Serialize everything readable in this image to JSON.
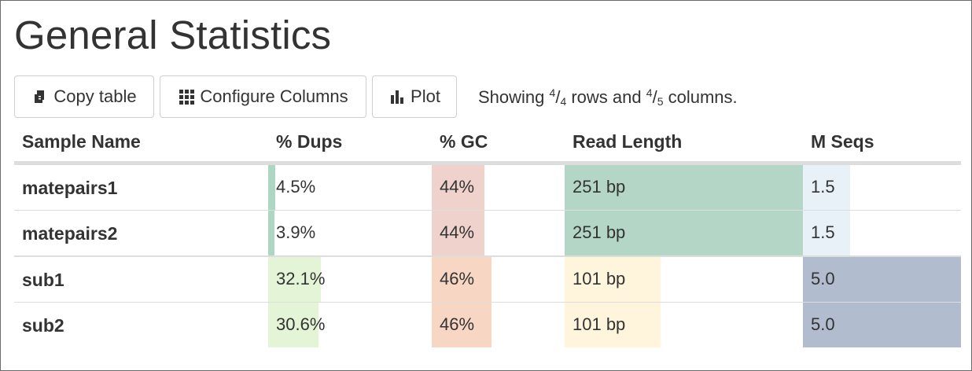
{
  "title": "General Statistics",
  "toolbar": {
    "copy_label": "Copy table",
    "configure_label": "Configure Columns",
    "plot_label": "Plot",
    "showing": {
      "prefix": "Showing",
      "rows_shown": "4",
      "rows_total": "4",
      "mid": "rows and",
      "cols_shown": "4",
      "cols_total": "5",
      "suffix": "columns."
    }
  },
  "columns": [
    "Sample Name",
    "% Dups",
    "% GC",
    "Read Length",
    "M Seqs"
  ],
  "colors": {
    "dups": [
      "#aed6c4",
      "#aed6c4",
      "#e4f4d6",
      "#e4f4d6"
    ],
    "gc": [
      "#f0d2cc",
      "#f0d2cc",
      "#f8d6c4",
      "#f8d6c4"
    ],
    "readlen": [
      "#b3d6c6",
      "#b3d6c6",
      "#fff4dc",
      "#fff4dc"
    ],
    "mseqs": [
      "#e8f0f8",
      "#e8f0f8",
      "#b2bccf",
      "#b2bccf"
    ]
  },
  "rows": [
    {
      "name": "matepairs1",
      "dups": "4.5%",
      "dups_frac": 0.045,
      "gc": "44%",
      "gc_frac": 0.44,
      "readlen": "251 bp",
      "readlen_frac": 1.0,
      "mseqs": "1.5",
      "mseqs_frac": 0.3
    },
    {
      "name": "matepairs2",
      "dups": "3.9%",
      "dups_frac": 0.039,
      "gc": "44%",
      "gc_frac": 0.44,
      "readlen": "251 bp",
      "readlen_frac": 1.0,
      "mseqs": "1.5",
      "mseqs_frac": 0.3
    },
    {
      "name": "sub1",
      "dups": "32.1%",
      "dups_frac": 0.321,
      "gc": "46%",
      "gc_frac": 0.46,
      "readlen": "101 bp",
      "readlen_frac": 0.402,
      "mseqs": "5.0",
      "mseqs_frac": 1.0
    },
    {
      "name": "sub2",
      "dups": "30.6%",
      "dups_frac": 0.306,
      "gc": "46%",
      "gc_frac": 0.46,
      "readlen": "101 bp",
      "readlen_frac": 0.402,
      "mseqs": "5.0",
      "mseqs_frac": 1.0
    }
  ]
}
